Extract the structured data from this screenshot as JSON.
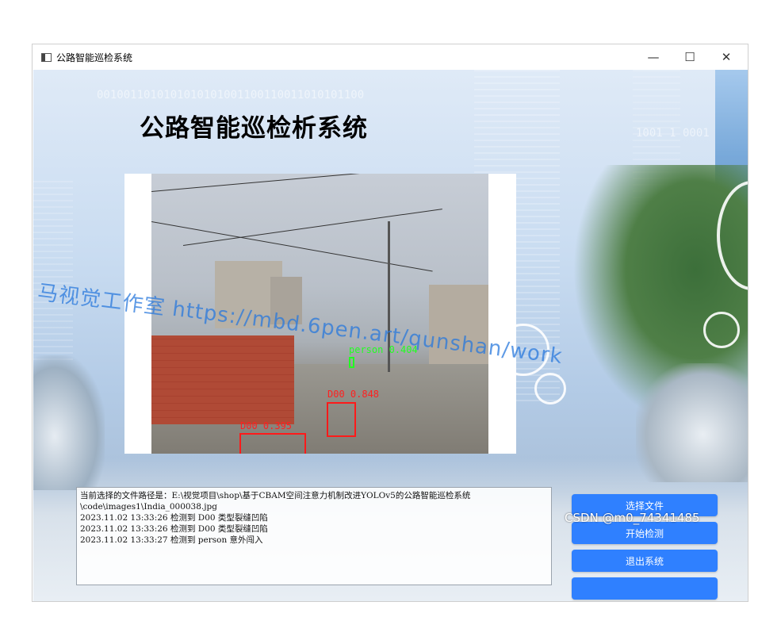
{
  "window": {
    "title": "公路智能巡检系统",
    "controls": {
      "minimize": "—",
      "maximize": "☐",
      "close": "✕"
    }
  },
  "app": {
    "heading": "公路智能巡检析系统"
  },
  "detections": [
    {
      "label": "person 0.404",
      "class": "person"
    },
    {
      "label": "D00 0.848",
      "class": "D00"
    },
    {
      "label": "D00 0.395",
      "class": "D00"
    }
  ],
  "photo_watermark": "马视觉工作室 https://mbd.6pen.art/qunshan/work",
  "log": {
    "lines": [
      "当前选择的文件路径是：E:\\视觉项目\\shop\\基于CBAM空间注意力机制改进YOLOv5的公路智能巡检系统",
      "\\code\\images1\\India_000038.jpg",
      "2023.11.02  13:33:26   检测到 D00 类型裂缝凹陷",
      "2023.11.02  13:33:26   检测到 D00 类型裂缝凹陷",
      "2023.11.02  13:33:27   检测到 person 意外闯入"
    ]
  },
  "buttons": {
    "select_file": "选择文件",
    "start_detect": "开始检测",
    "exit_system": "退出系统",
    "fourth": ""
  },
  "credit": "CSDN @m0_74341485",
  "colors": {
    "button": "#2f80ff",
    "detection_red": "#ff1a1a",
    "detection_green": "#22ff22"
  }
}
